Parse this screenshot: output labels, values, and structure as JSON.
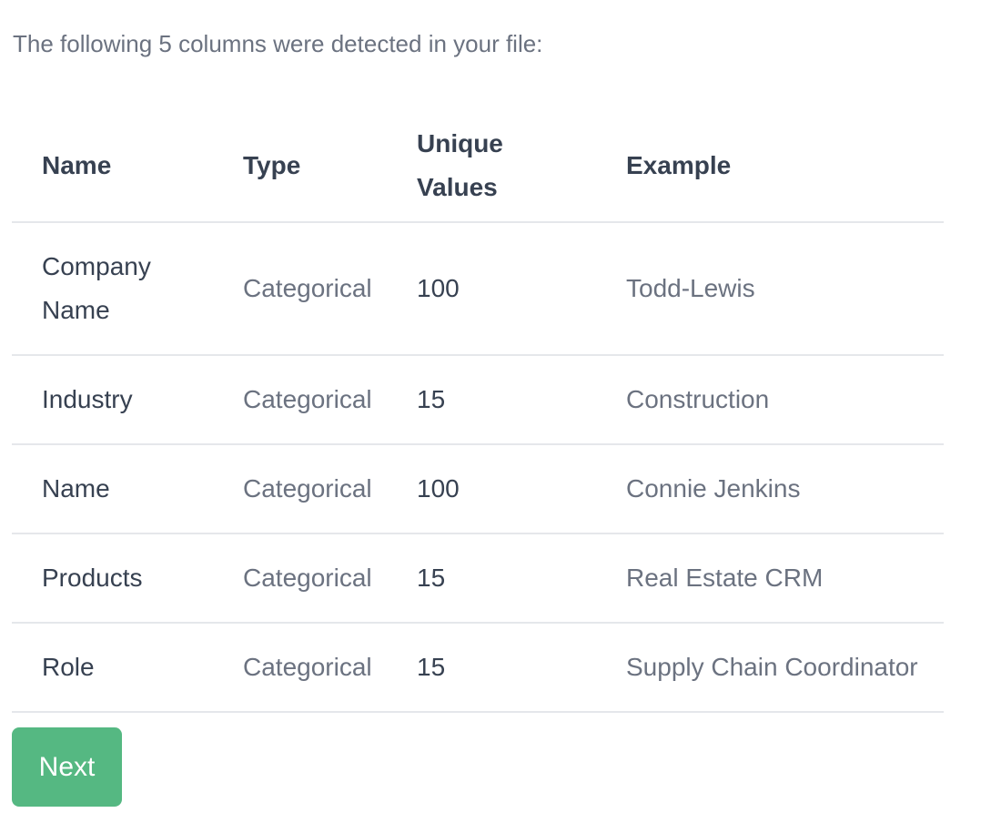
{
  "intro_text": "The following 5 columns were detected in your file:",
  "table": {
    "headers": {
      "name": "Name",
      "type": "Type",
      "unique": "Unique Values",
      "example": "Example"
    },
    "rows": [
      {
        "name": "Company Name",
        "type": "Categorical",
        "unique": "100",
        "example": "Todd-Lewis"
      },
      {
        "name": "Industry",
        "type": "Categorical",
        "unique": "15",
        "example": "Construction"
      },
      {
        "name": "Name",
        "type": "Categorical",
        "unique": "100",
        "example": "Connie Jenkins"
      },
      {
        "name": "Products",
        "type": "Categorical",
        "unique": "15",
        "example": "Real Estate CRM"
      },
      {
        "name": "Role",
        "type": "Categorical",
        "unique": "15",
        "example": "Supply Chain Coordinator"
      }
    ]
  },
  "next_button": {
    "label": "Next",
    "color": "#55b882"
  }
}
